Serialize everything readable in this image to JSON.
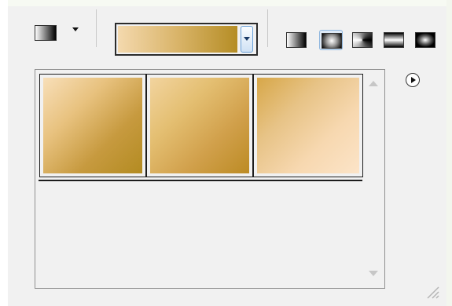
{
  "window": {
    "background": "#f1f1f1"
  },
  "toolbar": {
    "preset_picker": {
      "icon": "linear-gradient-swatch-icon",
      "has_dropdown": true
    },
    "gradient_combo": {
      "current_gradient": [
        "#f4d9ae",
        "#d9b469",
        "#b58d25"
      ],
      "dropdown_icon": "chevron-down-icon"
    },
    "gradient_types": [
      {
        "name": "linear",
        "icon": "linear-gradient-icon",
        "selected": false
      },
      {
        "name": "radial",
        "icon": "radial-gradient-icon",
        "selected": true
      },
      {
        "name": "angle",
        "icon": "angle-gradient-icon",
        "selected": false
      },
      {
        "name": "reflected",
        "icon": "reflected-gradient-icon",
        "selected": false
      },
      {
        "name": "diamond",
        "icon": "diamond-gradient-icon",
        "selected": false
      }
    ]
  },
  "gradient_library": {
    "swatches": [
      {
        "stops": [
          "#f8dfb9",
          "#e8c27f",
          "#c79a3f",
          "#b38b21"
        ]
      },
      {
        "stops": [
          "#f2d49f",
          "#e4bf72",
          "#d1a04b",
          "#bc8b24"
        ]
      },
      {
        "stops": [
          "#d7a748",
          "#e7c386",
          "#f7d8b0",
          "#fce4c8"
        ]
      }
    ],
    "scroll_up_icon": "scroll-up-arrow-icon",
    "scroll_down_icon": "scroll-down-arrow-icon"
  },
  "panel_menu": {
    "icon": "play-circle-icon"
  },
  "resize_grip": {
    "icon": "resize-grip-icon"
  }
}
